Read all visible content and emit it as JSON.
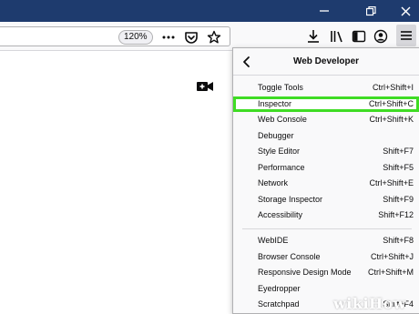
{
  "browser": {
    "zoom_level": "120%"
  },
  "menu": {
    "title": "Web Developer",
    "groups": [
      [
        {
          "label": "Toggle Tools",
          "shortcut": "Ctrl+Shift+I"
        },
        {
          "label": "Inspector",
          "shortcut": "Ctrl+Shift+C",
          "highlighted": true
        },
        {
          "label": "Web Console",
          "shortcut": "Ctrl+Shift+K"
        },
        {
          "label": "Debugger",
          "shortcut": ""
        },
        {
          "label": "Style Editor",
          "shortcut": "Shift+F7"
        },
        {
          "label": "Performance",
          "shortcut": "Shift+F5"
        },
        {
          "label": "Network",
          "shortcut": "Ctrl+Shift+E"
        },
        {
          "label": "Storage Inspector",
          "shortcut": "Shift+F9"
        },
        {
          "label": "Accessibility",
          "shortcut": "Shift+F12"
        }
      ],
      [
        {
          "label": "WebIDE",
          "shortcut": "Shift+F8"
        },
        {
          "label": "Browser Console",
          "shortcut": "Ctrl+Shift+J"
        },
        {
          "label": "Responsive Design Mode",
          "shortcut": "Ctrl+Shift+M"
        },
        {
          "label": "Eyedropper",
          "shortcut": ""
        },
        {
          "label": "Scratchpad",
          "shortcut": "Shift+F4"
        }
      ]
    ]
  },
  "watermark": {
    "text": "wikiHow"
  },
  "colors": {
    "titlebar": "#1e3b6e",
    "highlight_outline": "#3fdc24",
    "menu_bg": "#f9f9fa"
  }
}
